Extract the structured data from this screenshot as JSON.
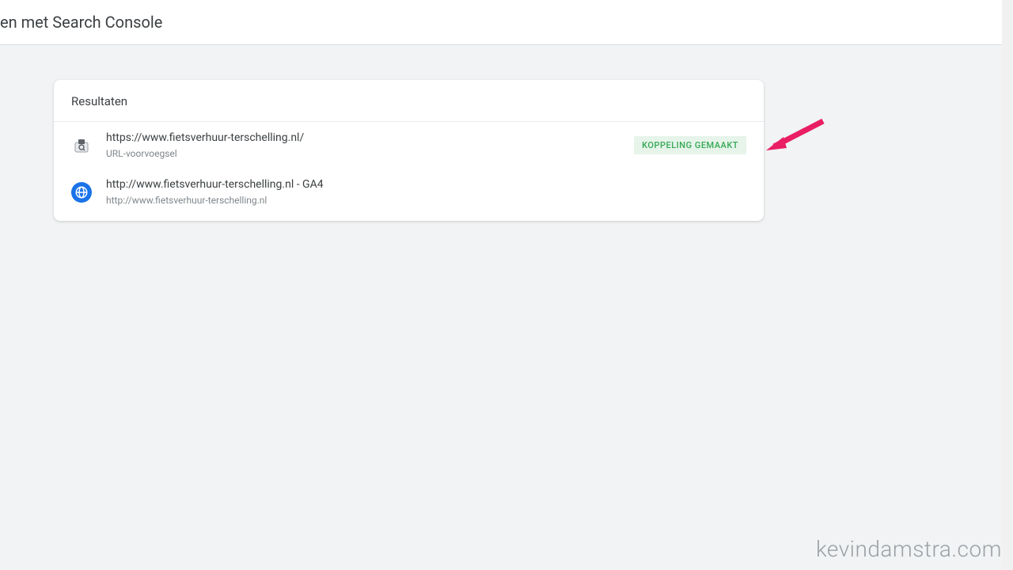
{
  "header": {
    "title": "en met Search Console"
  },
  "card": {
    "title": "Resultaten"
  },
  "results": [
    {
      "title": "https://www.fietsverhuur-terschelling.nl/",
      "subtitle": "URL-voorvoegsel",
      "badge": "KOPPELING GEMAAKT",
      "icon": "search-console"
    },
    {
      "title": "http://www.fietsverhuur-terschelling.nl - GA4",
      "subtitle": "http://www.fietsverhuur-terschelling.nl",
      "icon": "globe"
    }
  ],
  "watermark": "kevindamstra.com"
}
